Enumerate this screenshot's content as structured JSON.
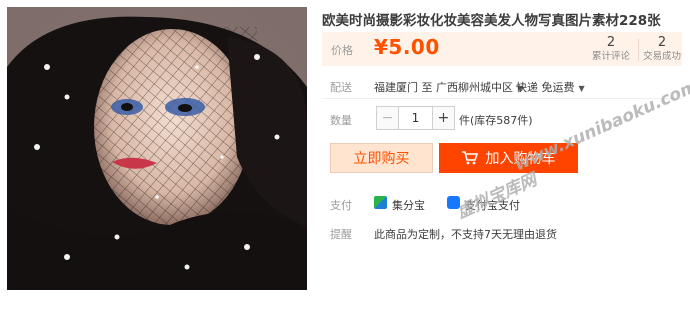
{
  "product": {
    "title": "欧美时尚摄影彩妆化妆美容美发人物写真图片素材228张",
    "image_icon": "woman-portrait-with-veil"
  },
  "price": {
    "label": "价格",
    "value": "¥5.00",
    "reviews_count": "2",
    "reviews_label": "累计评论",
    "sales_count": "2",
    "sales_label": "交易成功"
  },
  "shipping": {
    "label": "配送",
    "from_to": "福建厦门 至 广西柳州城中区",
    "method": "快递 免运费"
  },
  "quantity": {
    "label": "数量",
    "value": "1",
    "minus": "−",
    "plus": "+",
    "stock_text": "件(库存587件)"
  },
  "actions": {
    "buy_now": "立即购买",
    "add_to_cart": "加入购物车"
  },
  "payment": {
    "label": "支付",
    "option1": "集分宝",
    "option2": "支付宝支付"
  },
  "notice": {
    "label": "提醒",
    "text": "此商品为定制，不支持7天无理由退货"
  },
  "watermark": {
    "site": "www.xunibaoku.com",
    "cn": "虚拟宝库网"
  },
  "colors": {
    "accent": "#ff5000",
    "cart_button": "#ff4400",
    "price_band": "#fff2e8"
  }
}
